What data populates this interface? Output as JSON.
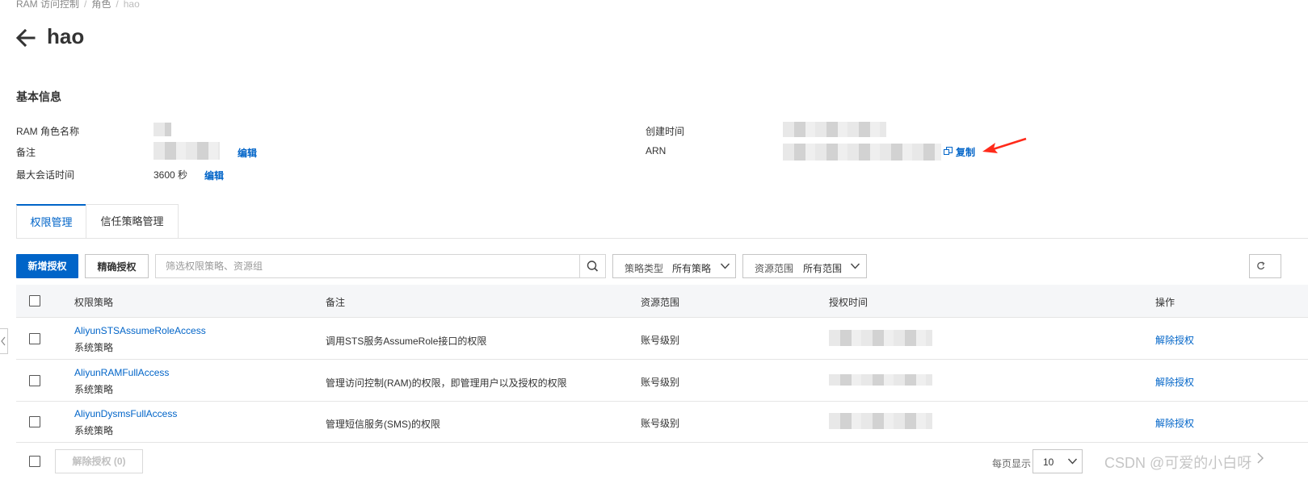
{
  "breadcrumb": {
    "items": [
      "RAM 访问控制",
      "角色"
    ],
    "separator": "/",
    "current": "hao"
  },
  "header": {
    "title": "hao"
  },
  "basic_info": {
    "section_title": "基本信息",
    "role_name_label": "RAM 角色名称",
    "note_label": "备注",
    "note_edit": "编辑",
    "max_session_label": "最大会话时间",
    "max_session_value": "3600 秒",
    "max_session_edit": "编辑",
    "created_time_label": "创建时间",
    "arn_label": "ARN",
    "copy_label": "复制"
  },
  "tabs": [
    {
      "label": "权限管理",
      "active": true
    },
    {
      "label": "信任策略管理",
      "active": false
    }
  ],
  "toolbar": {
    "new_grant": "新增授权",
    "precise_grant": "精确授权",
    "search_placeholder": "筛选权限策略、资源组",
    "policy_type_label": "策略类型",
    "policy_type_value": "所有策略",
    "scope_label": "资源范围",
    "scope_value": "所有范围"
  },
  "table": {
    "headers": [
      "权限策略",
      "备注",
      "资源范围",
      "授权时间",
      "操作"
    ],
    "rows": [
      {
        "policy": "AliyunSTSAssumeRoleAccess",
        "type": "系统策略",
        "note": "调用STS服务AssumeRole接口的权限",
        "scope": "账号级别",
        "action": "解除授权"
      },
      {
        "policy": "AliyunRAMFullAccess",
        "type": "系统策略",
        "note": "管理访问控制(RAM)的权限，即管理用户以及授权的权限",
        "scope": "账号级别",
        "action": "解除授权"
      },
      {
        "policy": "AliyunDysmsFullAccess",
        "type": "系统策略",
        "note": "管理短信服务(SMS)的权限",
        "scope": "账号级别",
        "action": "解除授权"
      }
    ]
  },
  "footer": {
    "bulk_revoke": "解除授权 (0)",
    "page_size_label": "每页显示",
    "page_size_value": "10",
    "next_icon": "chevron-right-icon"
  },
  "watermark": "CSDN @可爱的小白呀",
  "colors": {
    "accent": "#0064c8",
    "annotation_arrow": "#ff2a1a",
    "header_bg": "#f5f6f8"
  }
}
